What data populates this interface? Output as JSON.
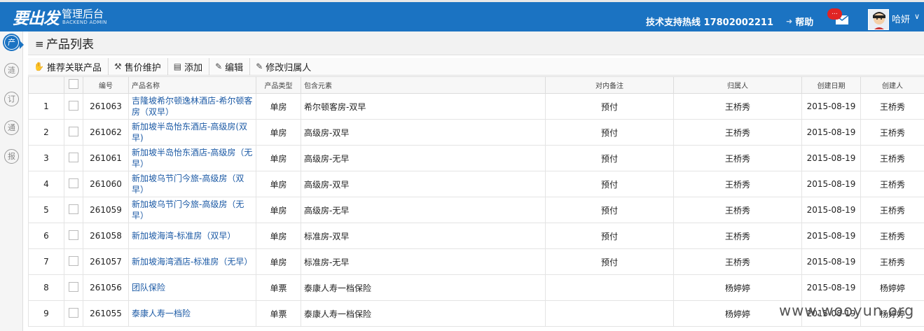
{
  "header": {
    "logo": "要出发",
    "brand_main": "管理后台",
    "brand_sub": "BACKEND ADMIN",
    "hotline": "技术支持热线 17802002211",
    "help": "帮助",
    "badge": "...",
    "username": "哈妍",
    "accent": "#1b73c2"
  },
  "sidebar": {
    "items": [
      {
        "label": "产",
        "icon": "product-icon"
      },
      {
        "label": "涟",
        "icon": "link-icon"
      },
      {
        "label": "订",
        "icon": "order-icon"
      },
      {
        "label": "通",
        "icon": "notice-icon"
      },
      {
        "label": "报",
        "icon": "report-icon"
      }
    ]
  },
  "page": {
    "title": "产品列表"
  },
  "toolbar": {
    "recommend": "推荐关联产品",
    "price": "售价维护",
    "add": "添加",
    "edit": "编辑",
    "owner": "修改归属人"
  },
  "table": {
    "headers": [
      "编号",
      "产品名称",
      "产品类型",
      "包含元素",
      "对内备注",
      "归属人",
      "创建日期",
      "创建人"
    ],
    "rows": [
      {
        "no": "1",
        "id": "261063",
        "name": "吉隆坡希尔顿逸林酒店-希尔顿客房（双早）",
        "type": "单房",
        "elements": "希尔顿客房-双早",
        "remark": "预付",
        "owner": "王桥秀",
        "date": "2015-08-19",
        "creator": "王桥秀"
      },
      {
        "no": "2",
        "id": "261062",
        "name": "新加坡半岛怡东酒店-高级房(双早)",
        "type": "单房",
        "elements": "高级房-双早",
        "remark": "预付",
        "owner": "王桥秀",
        "date": "2015-08-19",
        "creator": "王桥秀"
      },
      {
        "no": "3",
        "id": "261061",
        "name": "新加坡半岛怡东酒店-高级房（无早）",
        "type": "单房",
        "elements": "高级房-无早",
        "remark": "预付",
        "owner": "王桥秀",
        "date": "2015-08-19",
        "creator": "王桥秀"
      },
      {
        "no": "4",
        "id": "261060",
        "name": "新加坡乌节门今旅-高级房（双早）",
        "type": "单房",
        "elements": "高级房-双早",
        "remark": "预付",
        "owner": "王桥秀",
        "date": "2015-08-19",
        "creator": "王桥秀"
      },
      {
        "no": "5",
        "id": "261059",
        "name": "新加坡乌节门今旅-高级房（无早）",
        "type": "单房",
        "elements": "高级房-无早",
        "remark": "预付",
        "owner": "王桥秀",
        "date": "2015-08-19",
        "creator": "王桥秀"
      },
      {
        "no": "6",
        "id": "261058",
        "name": "新加坡海湾-标准房（双早）",
        "type": "单房",
        "elements": "标准房-双早",
        "remark": "预付",
        "owner": "王桥秀",
        "date": "2015-08-19",
        "creator": "王桥秀"
      },
      {
        "no": "7",
        "id": "261057",
        "name": "新加坡海湾酒店-标准房（无早）",
        "type": "单房",
        "elements": "标准房-无早",
        "remark": "预付",
        "owner": "王桥秀",
        "date": "2015-08-19",
        "creator": "王桥秀"
      },
      {
        "no": "8",
        "id": "261056",
        "name": "团队保险",
        "type": "单票",
        "elements": "泰康人寿一档保险",
        "remark": "",
        "owner": "杨婷婷",
        "date": "2015-08-19",
        "creator": "杨婷婷"
      },
      {
        "no": "9",
        "id": "261055",
        "name": "泰康人寿一档险",
        "type": "单票",
        "elements": "泰康人寿一档保险",
        "remark": "",
        "owner": "杨婷婷",
        "date": "2015-08-19",
        "creator": "杨婷婷"
      }
    ]
  },
  "watermark": "www.wooyun.org"
}
